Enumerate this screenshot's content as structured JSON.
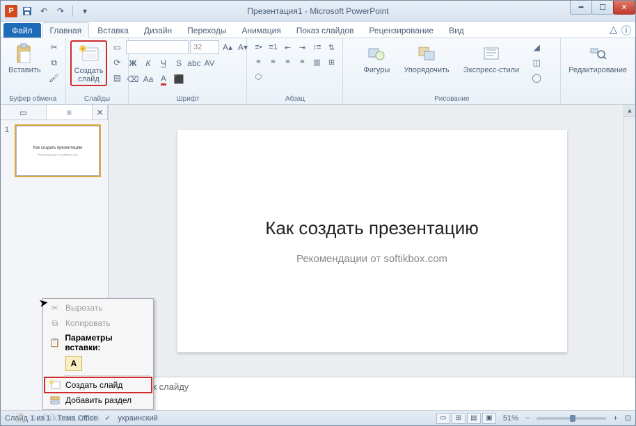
{
  "title": "Презентация1 - Microsoft PowerPoint",
  "app_letter": "P",
  "tabs": {
    "file": "Файл",
    "items": [
      "Главная",
      "Вставка",
      "Дизайн",
      "Переходы",
      "Анимация",
      "Показ слайдов",
      "Рецензирование",
      "Вид"
    ],
    "active_index": 0
  },
  "ribbon": {
    "clipboard": {
      "label": "Буфер обмена",
      "paste": "Вставить"
    },
    "slides": {
      "label": "Слайды",
      "new_slide": "Создать\nслайд"
    },
    "font": {
      "label": "Шрифт",
      "size": "32"
    },
    "paragraph": {
      "label": "Абзац"
    },
    "drawing": {
      "label": "Рисование",
      "shapes": "Фигуры",
      "arrange": "Упорядочить",
      "styles": "Экспресс-стили"
    },
    "editing": {
      "label": "Редактирование"
    }
  },
  "side": {
    "slide_number": "1"
  },
  "slide": {
    "title": "Как создать презентацию",
    "subtitle": "Рекомендации от softikbox.com"
  },
  "context_menu": {
    "cut": "Вырезать",
    "copy": "Копировать",
    "paste_header": "Параметры вставки:",
    "paste_letter": "А",
    "new_slide": "Создать слайд",
    "add_section": "Добавить раздел"
  },
  "notes_placeholder": "Заметки к слайду",
  "statusbar": {
    "slide_info": "Слайд 1 из 1",
    "theme": "Тема Office",
    "lang": "украинский",
    "zoom": "51%"
  },
  "watermark": "softikbox.com"
}
